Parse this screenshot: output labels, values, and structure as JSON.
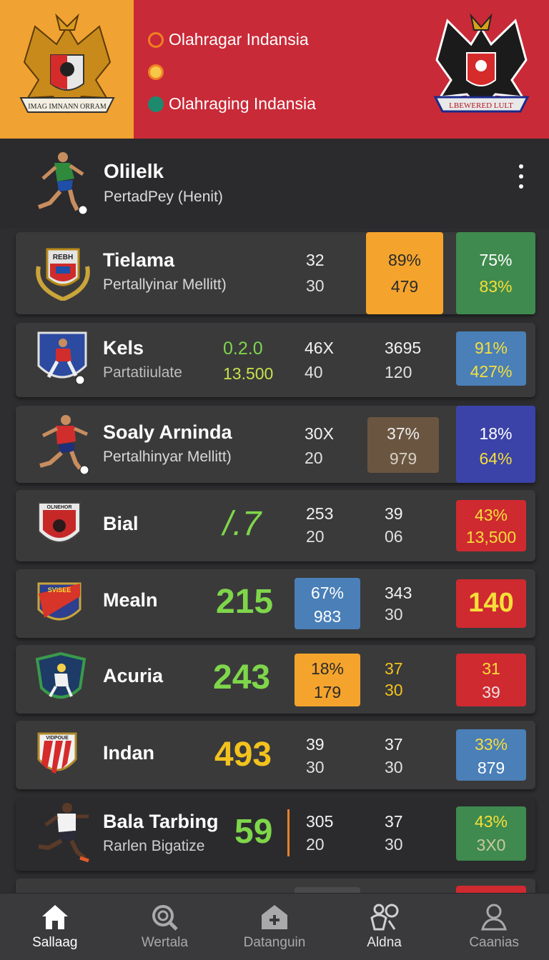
{
  "colors": {
    "banner_left": "#f0a232",
    "banner_right": "#c92a38",
    "green_big": "#7ed64a",
    "yellow_big": "#f2c21e",
    "orange_tile": "#f4a42c",
    "green_tile": "#3f8a4e",
    "blue_tile": "#4a7fb8",
    "purple_tile": "#3b43a8",
    "red_tile": "#cf2a30"
  },
  "banner": {
    "emblem_left_text": "IMAG IMNANN ORRAM",
    "emblem_right_text": "LBEWERED LULT",
    "line1": "Olahragar Indansia",
    "line3": "Olahraging Indansia"
  },
  "feature": {
    "title": "Olilelk",
    "subtitle": "PertadPey (Henit)"
  },
  "rows": [
    {
      "name": "Tielama",
      "sub": "Pertallyinar Mellitt)",
      "logo_text": "REBH",
      "c1": [
        "32",
        "30"
      ],
      "t1": [
        "89%",
        "479"
      ],
      "t2": [
        "75%",
        "83%"
      ]
    },
    {
      "name": "Kels",
      "sub": "Partatiiulate",
      "g": [
        "0.2.0",
        "13.500"
      ],
      "c1": [
        "46X",
        "40"
      ],
      "c2": [
        "3695",
        "120"
      ],
      "t2": [
        "91%",
        "427%"
      ]
    },
    {
      "name": "Soaly Arninda",
      "sub": "Pertalhinyar Mellitt)",
      "c1": [
        "30X",
        "20"
      ],
      "t1": [
        "37%",
        "979"
      ],
      "t2": [
        "18%",
        "64%"
      ]
    },
    {
      "name": "Bial",
      "logo_text": "OLNEHOR",
      "big": "/.7",
      "c1": [
        "253",
        "20"
      ],
      "c2": [
        "39",
        "06"
      ],
      "t2": [
        "43%",
        "13,500"
      ]
    },
    {
      "name": "Mealn",
      "logo_text": "SVISEE",
      "big": "215",
      "t1": [
        "67%",
        "983"
      ],
      "c2": [
        "343",
        "30"
      ],
      "t2": [
        "140"
      ]
    },
    {
      "name": "Acuria",
      "big": "243",
      "t1": [
        "18%",
        "179"
      ],
      "c2": [
        "37",
        "30"
      ],
      "t2": [
        "31",
        "39"
      ]
    },
    {
      "name": "Indan",
      "logo_text": "VIDPOUE",
      "big": "493",
      "c1": [
        "39",
        "30"
      ],
      "c2": [
        "37",
        "30"
      ],
      "t2": [
        "33%",
        "879"
      ]
    },
    {
      "name": "Bala Tarbing",
      "sub": "Rarlen Bigatize",
      "big": "59",
      "c1": [
        "305",
        "20"
      ],
      "c2": [
        "37",
        "30"
      ],
      "t2": [
        "43%",
        "3X0"
      ]
    }
  ],
  "nav": [
    {
      "label": "Sallaag",
      "icon": "home-icon",
      "active": true
    },
    {
      "label": "Wertala",
      "icon": "search-icon",
      "active": false
    },
    {
      "label": "Datanguin",
      "icon": "house-plus-icon",
      "active": false
    },
    {
      "label": "Aldna",
      "icon": "players-icon",
      "active": false
    },
    {
      "label": "Caanias",
      "icon": "user-icon",
      "active": false
    }
  ]
}
